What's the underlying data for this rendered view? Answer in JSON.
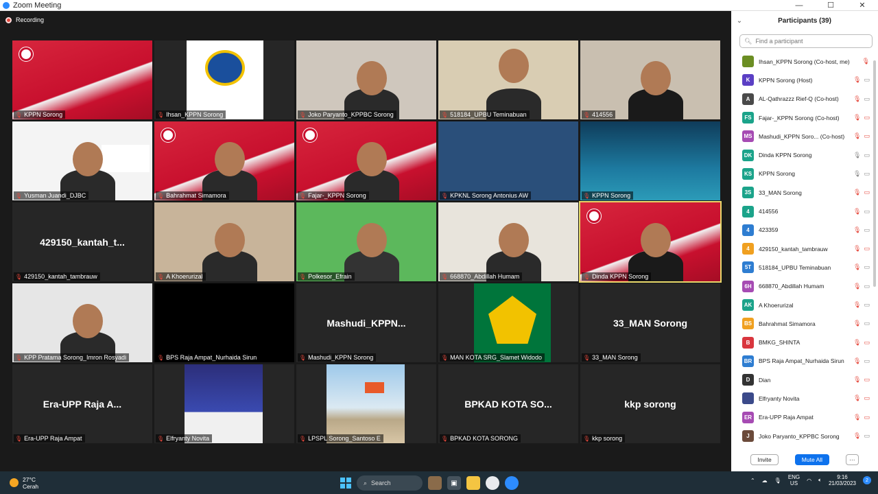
{
  "window": {
    "title": "Zoom Meeting",
    "min": "—",
    "max": "☐",
    "close": "✕"
  },
  "recording": "Recording",
  "tiles": [
    {
      "name": "KPPN Sorong",
      "bg": "asean"
    },
    {
      "name": "Ihsan_KPPN Sorong",
      "bg": "kemenkeu"
    },
    {
      "name": "Joko Paryanto_KPPBC Sorong",
      "bg": "room"
    },
    {
      "name": "518184_UPBU Teminabuan",
      "bg": "cam"
    },
    {
      "name": "414556",
      "bg": "cam2"
    },
    {
      "name": "Yusman Juandi_DJBC",
      "bg": "press"
    },
    {
      "name": "Bahrahmat Simamora",
      "bg": "asean"
    },
    {
      "name": "Fajar-_KPPN Sorong",
      "bg": "asean"
    },
    {
      "name": "KPKNL Sorong Antonius AW",
      "bg": "slide"
    },
    {
      "name": "KPPN Sorong",
      "bg": "papua"
    },
    {
      "name": "429150_kantah_tambrauw",
      "bg": "name",
      "label": "429150_kantah_t..."
    },
    {
      "name": "A Khoerurizal",
      "bg": "books"
    },
    {
      "name": "Polkesor_Efrain",
      "bg": "green"
    },
    {
      "name": "668870_Abdillah Humam",
      "bg": "office"
    },
    {
      "name": "Dinda KPPN Sorong",
      "bg": "asean",
      "active": true
    },
    {
      "name": "KPP Pratama Sorong_Imron Rosyadi",
      "bg": "white"
    },
    {
      "name": "BPS Raja Ampat_Nurhaida Sirun",
      "bg": "black"
    },
    {
      "name": "Mashudi_KPPN Sorong",
      "bg": "name",
      "label": "Mashudi_KPPN..."
    },
    {
      "name": "MAN KOTA SRG_Slamet Widodo",
      "bg": "kemenag"
    },
    {
      "name": "33_MAN Sorong",
      "bg": "name",
      "label": "33_MAN Sorong"
    },
    {
      "name": "Era-UPP Raja Ampat",
      "bg": "name",
      "label": "Era-UPP Raja A..."
    },
    {
      "name": "Elfryanty Novita",
      "bg": "bluedoc"
    },
    {
      "name": "LPSPL Sorong_Santoso E",
      "bg": "beach"
    },
    {
      "name": "BPKAD KOTA SORONG",
      "bg": "name",
      "label": "BPKAD KOTA SO..."
    },
    {
      "name": "kkp sorong",
      "bg": "name",
      "label": "kkp sorong"
    }
  ],
  "panel": {
    "title": "Participants (39)",
    "search_placeholder": "Find a participant",
    "participants": [
      {
        "name": "Ihsan_KPPN Sorong (Co-host, me)",
        "initials": "",
        "color": "#6b8e23",
        "mic": "muted",
        "video": ""
      },
      {
        "name": "KPPN Sorong (Host)",
        "initials": "K",
        "color": "#5b3fc4",
        "mic": "muted",
        "video": "on"
      },
      {
        "name": "AL-Qathrazzz Rief-Q (Co-host)",
        "initials": "A",
        "color": "#4a4a4a",
        "mic": "muted",
        "video": "on"
      },
      {
        "name": "Fajar-_KPPN Sorong (Co-host)",
        "initials": "FS",
        "color": "#1ba38a",
        "mic": "muted",
        "video": "off"
      },
      {
        "name": "Mashudi_KPPN Soro... (Co-host)",
        "initials": "MS",
        "color": "#a64bb3",
        "mic": "muted",
        "video": "off"
      },
      {
        "name": "Dinda KPPN Sorong",
        "initials": "DK",
        "color": "#1ba38a",
        "mic": "on",
        "video": "on"
      },
      {
        "name": "KPPN Sorong",
        "initials": "KS",
        "color": "#1ba38a",
        "mic": "on",
        "video": "on"
      },
      {
        "name": "33_MAN Sorong",
        "initials": "3S",
        "color": "#1ba38a",
        "mic": "muted",
        "video": "off"
      },
      {
        "name": "414556",
        "initials": "4",
        "color": "#1ba38a",
        "mic": "muted",
        "video": "on"
      },
      {
        "name": "423359",
        "initials": "4",
        "color": "#2e7dd1",
        "mic": "muted",
        "video": "on"
      },
      {
        "name": "429150_kantah_tambrauw",
        "initials": "4",
        "color": "#f0a020",
        "mic": "muted",
        "video": "off"
      },
      {
        "name": "518184_UPBU Teminabuan",
        "initials": "5T",
        "color": "#2e7dd1",
        "mic": "muted",
        "video": "on"
      },
      {
        "name": "668870_Abdillah Humam",
        "initials": "6H",
        "color": "#a64bb3",
        "mic": "muted",
        "video": "on"
      },
      {
        "name": "A Khoerurizal",
        "initials": "AK",
        "color": "#1ba38a",
        "mic": "muted",
        "video": "on"
      },
      {
        "name": "Bahrahmat Simamora",
        "initials": "BS",
        "color": "#f0a020",
        "mic": "muted",
        "video": "on"
      },
      {
        "name": "BMKG_SHINTA",
        "initials": "B",
        "color": "#d9363e",
        "mic": "muted",
        "video": "off"
      },
      {
        "name": "BPS Raja Ampat_Nurhaida Sirun",
        "initials": "BR",
        "color": "#2e7dd1",
        "mic": "muted",
        "video": "on"
      },
      {
        "name": "Dian",
        "initials": "D",
        "color": "#333333",
        "mic": "muted",
        "video": "off"
      },
      {
        "name": "Elfryanty Novita",
        "initials": "",
        "color": "#3b4a8a",
        "mic": "muted",
        "video": "off"
      },
      {
        "name": "Era-UPP Raja Ampat",
        "initials": "ER",
        "color": "#a64bb3",
        "mic": "muted",
        "video": "off"
      },
      {
        "name": "Joko Paryanto_KPPBC Sorong",
        "initials": "J",
        "color": "#6b4a3a",
        "mic": "muted",
        "video": "on"
      }
    ],
    "invite": "Invite",
    "mute_all": "Mute All",
    "more": "···"
  },
  "taskbar": {
    "temp": "27°C",
    "weather": "Cerah",
    "search": "Search",
    "lang1": "ENG",
    "lang2": "US",
    "time": "9:16",
    "date": "21/03/2023",
    "notif": "2"
  }
}
